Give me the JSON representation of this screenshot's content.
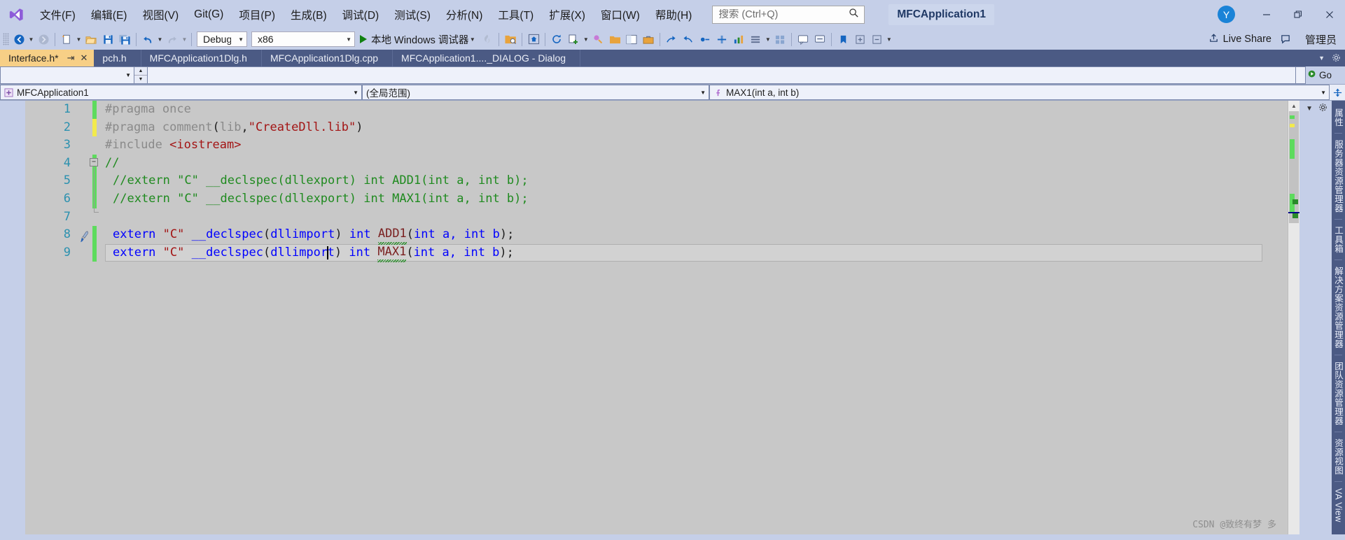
{
  "window": {
    "title": "MFCApplication1",
    "admin_label": "管理员",
    "avatar_initial": "Y",
    "minimize": "—",
    "restore": "❐",
    "close": "✕"
  },
  "menu": {
    "items": [
      {
        "label": "文件(F)"
      },
      {
        "label": "编辑(E)"
      },
      {
        "label": "视图(V)"
      },
      {
        "label": "Git(G)"
      },
      {
        "label": "项目(P)"
      },
      {
        "label": "生成(B)"
      },
      {
        "label": "调试(D)"
      },
      {
        "label": "测试(S)"
      },
      {
        "label": "分析(N)"
      },
      {
        "label": "工具(T)"
      },
      {
        "label": "扩展(X)"
      },
      {
        "label": "窗口(W)"
      },
      {
        "label": "帮助(H)"
      }
    ]
  },
  "search": {
    "placeholder": "搜索 (Ctrl+Q)",
    "value": ""
  },
  "toolbar": {
    "configuration": "Debug",
    "platform": "x86",
    "run_label": "本地 Windows 调试器",
    "live_share": "Live Share"
  },
  "tabs": [
    {
      "label": "Interface.h*",
      "active": true,
      "modified": true,
      "pin": "⇥",
      "close": "✕"
    },
    {
      "label": "pch.h",
      "active": false
    },
    {
      "label": "MFCApplication1Dlg.h",
      "active": false
    },
    {
      "label": "MFCApplication1Dlg.cpp",
      "active": false
    },
    {
      "label": "MFCApplication1...._DIALOG - Dialog",
      "active": false
    }
  ],
  "navbar": {
    "va_combo_value": "",
    "va_input_value": "",
    "go_label": "Go",
    "project": "MFCApplication1",
    "scope": "(全局范围)",
    "member": "MAX1(int a, int b)"
  },
  "editor": {
    "lines": [
      {
        "num": "1",
        "change": "green",
        "text": "#pragma once"
      },
      {
        "num": "2",
        "change": "yellow",
        "text": "#pragma comment(lib,\"CreateDll.lib\")"
      },
      {
        "num": "3",
        "change": "none",
        "text": "#include <iostream>"
      },
      {
        "num": "4",
        "change": "green",
        "text": "//"
      },
      {
        "num": "5",
        "change": "green",
        "text": "//extern \"C\" __declspec(dllexport) int ADD1(int a, int b);"
      },
      {
        "num": "6",
        "change": "green",
        "text": "//extern \"C\" __declspec(dllexport) int MAX1(int a, int b);"
      },
      {
        "num": "7",
        "change": "none",
        "text": ""
      },
      {
        "num": "8",
        "change": "green",
        "text": "extern \"C\" __declspec(dllimport) int ADD1(int a, int b);"
      },
      {
        "num": "9",
        "change": "green",
        "text": "extern \"C\" __declspec(dllimport) int MAX1(int a, int b);"
      }
    ],
    "tokens": {
      "pragma_once": "#pragma once",
      "pragma_comment": "#pragma comment",
      "lib_str": "\"CreateDll.lib\"",
      "lib_word": "lib",
      "include": "#include",
      "iostream": "<iostream>",
      "slashslash": "//",
      "cmt5": "//extern \"C\" __declspec(dllexport) int ADD1(int a, int b);",
      "cmt6": "//extern \"C\" __declspec(dllexport) int MAX1(int a, int b);",
      "extern": "extern",
      "c_str": "\"C\"",
      "declspec": "__declspec",
      "dllimport": "dllimport",
      "int": "int",
      "add1": "ADD1",
      "max1": "MAX1",
      "args_open": "(",
      "arg_a": "int a,",
      "arg_b": "int b",
      "args_close": ");",
      "dllimport_pre": "dllimpor",
      "dllimport_post": "t"
    },
    "fold_glyph": "−"
  },
  "right_rail": {
    "items": [
      {
        "label": "属性"
      },
      {
        "label": "服务器资源管理器"
      },
      {
        "label": "工具箱"
      },
      {
        "label": "解决方案资源管理器"
      },
      {
        "label": "团队资源管理器"
      },
      {
        "label": "资源视图"
      },
      {
        "label": "VA View"
      }
    ]
  },
  "watermark": "CSDN @致终有梦 多",
  "colors": {
    "chrome": "#c5cfe8",
    "tabstrip": "#4b5a84",
    "active_tab": "#f7cf86",
    "editor_bg": "#c8c8c8",
    "keyword": "#0000ff",
    "string": "#a31515",
    "comment": "#1f8a1f",
    "preprocessor": "#8a8a8a",
    "function": "#7a2020",
    "change_green": "#5ddb5d",
    "change_yellow": "#f2ea4c",
    "accent_blue": "#1a83d7"
  }
}
